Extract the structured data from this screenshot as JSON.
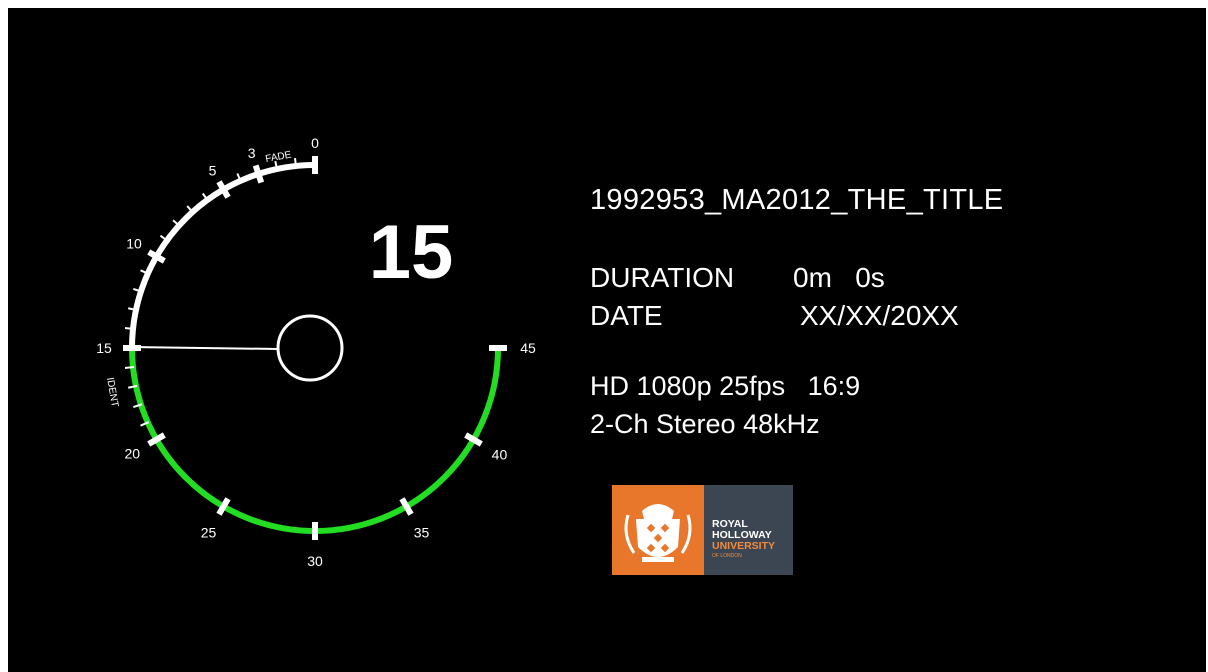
{
  "countdown": {
    "value": "15",
    "ident_label": "IDENT",
    "fade_label": "FADE",
    "scale_labels": [
      "0",
      "3",
      "5",
      "10",
      "15",
      "20",
      "25",
      "30",
      "35",
      "40",
      "45"
    ],
    "elapsed_color": "#22dd22",
    "remaining_color": "#ffffff"
  },
  "clip": {
    "title": "1992953_MA2012_THE_TITLE",
    "duration_label": "DURATION",
    "duration_value": "0m   0s",
    "date_label": "DATE",
    "date_value": "XX/XX/20XX",
    "video_format": "HD 1080p 25fps   16:9",
    "audio_format": "2-Ch Stereo 48kHz"
  },
  "logo": {
    "line1": "ROYAL",
    "line2": "HOLLOWAY",
    "line3": "UNIVERSITY",
    "line4": "OF LONDON",
    "crest_icon": "crest-icon",
    "left_color": "#e8762b",
    "right_color": "#3c4652"
  }
}
